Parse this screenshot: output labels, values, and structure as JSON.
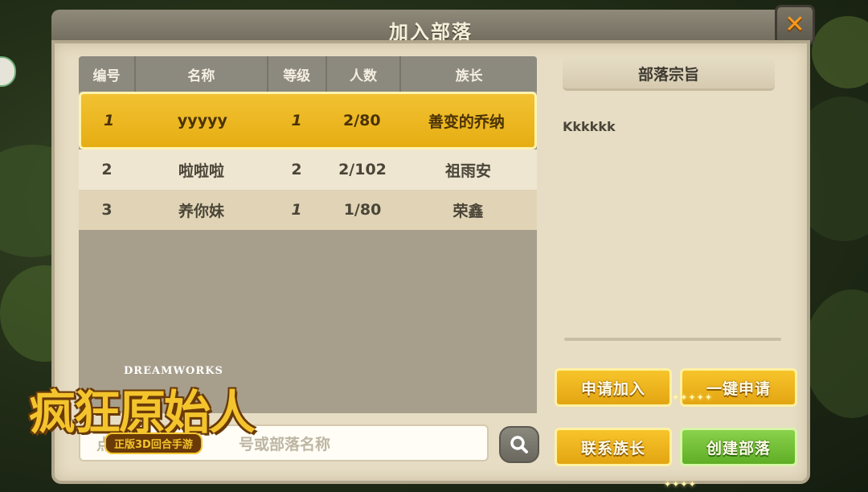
{
  "dialog": {
    "title": "加入部落",
    "close_label": "✕"
  },
  "table": {
    "headers": [
      "编号",
      "名称",
      "等级",
      "人数",
      "族长"
    ],
    "rows": [
      {
        "no": "1",
        "name": "yyyyy",
        "level": "1",
        "members": "2/80",
        "chief": "善变的乔纳",
        "selected": true
      },
      {
        "no": "2",
        "name": "啦啦啦",
        "level": "2",
        "members": "2/102",
        "chief": "祖雨安",
        "selected": false
      },
      {
        "no": "3",
        "name": "养你妹",
        "level": "1",
        "members": "1/80",
        "chief": "荣鑫",
        "selected": false
      }
    ]
  },
  "search": {
    "placeholder_visible": "点",
    "placeholder_visible_tail": "号或部落名称"
  },
  "purpose": {
    "header": "部落宗旨",
    "text": "Kkkkkk"
  },
  "buttons": {
    "apply": "申请加入",
    "one_click_apply": "一键申请",
    "contact_chief": "联系族长",
    "create_tribe": "创建部落"
  },
  "logo": {
    "brand": "DREAMWORKS",
    "title": "疯狂原始人",
    "subtitle": "正版3D回合手游"
  },
  "colors": {
    "selected_row": "#f2c233",
    "yellow_button": "#f7c42b",
    "green_button": "#6fc02f",
    "panel": "#e7ddc4"
  }
}
